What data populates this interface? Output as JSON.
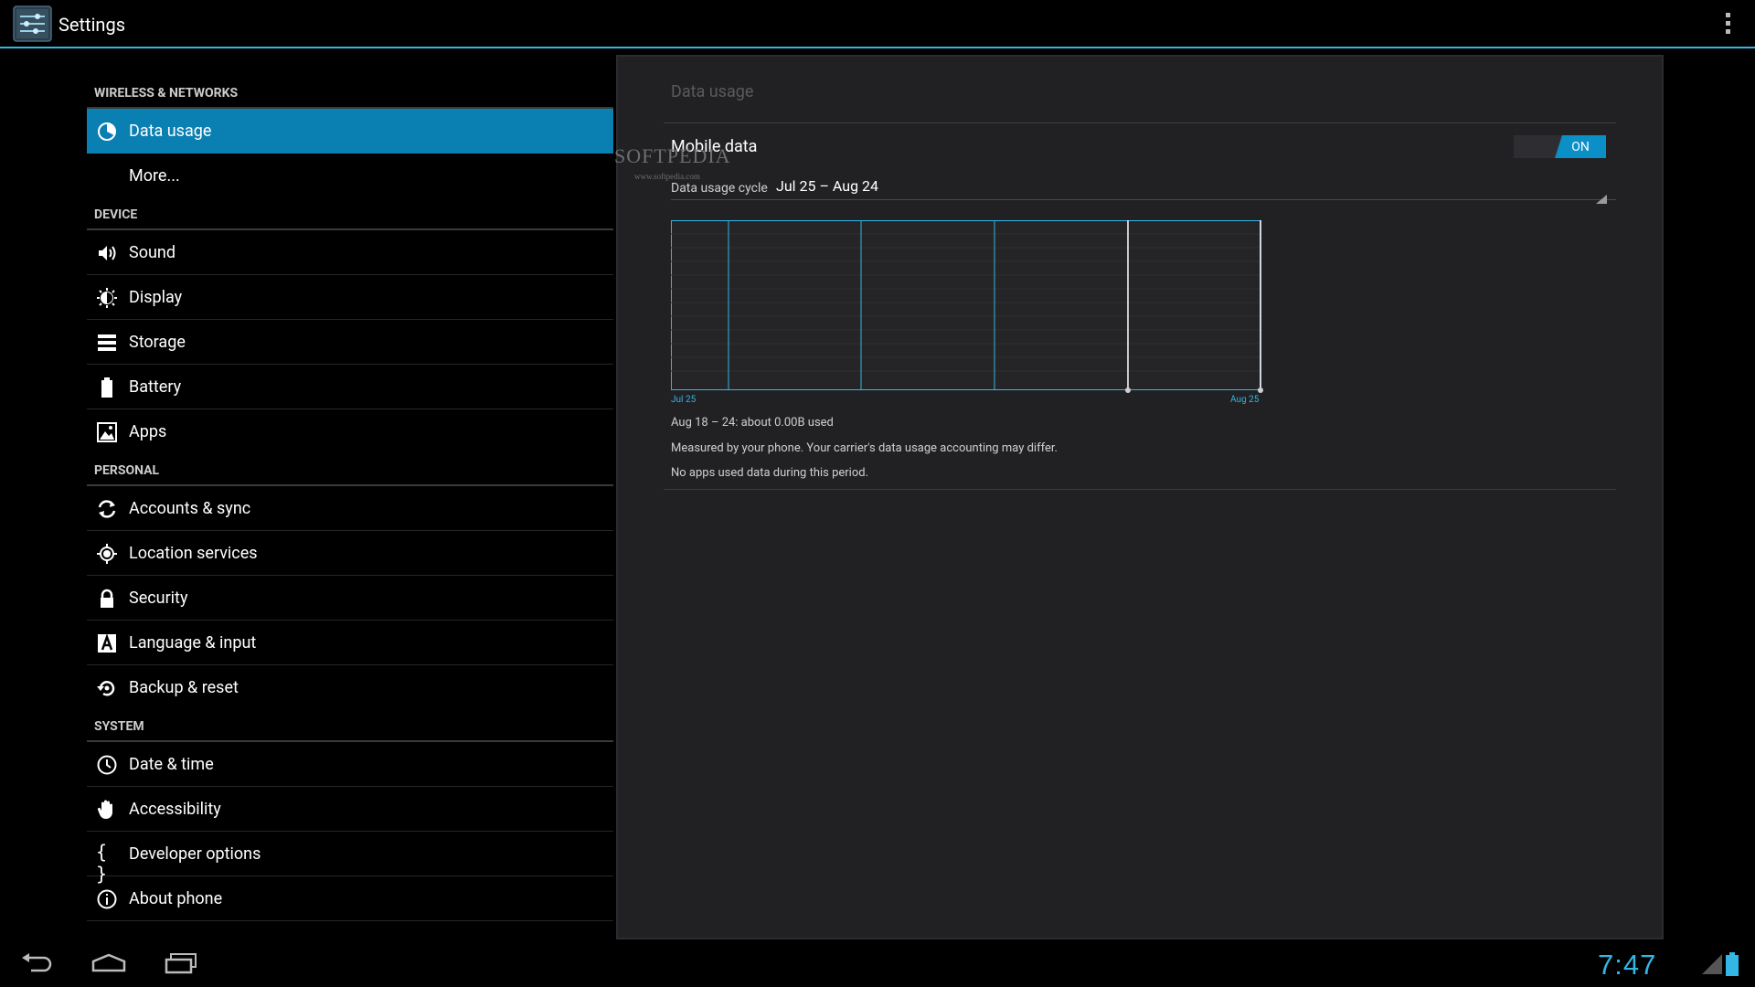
{
  "actionbar": {
    "title": "Settings",
    "icon": "settings-app-icon",
    "overflow_icon": "overflow-menu-icon"
  },
  "left": {
    "sections": [
      {
        "header": "WIRELESS & NETWORKS",
        "items": [
          {
            "label": "Data usage",
            "icon": "data-usage-icon",
            "selected": true
          },
          {
            "label": "More...",
            "icon": ""
          }
        ]
      },
      {
        "header": "DEVICE",
        "items": [
          {
            "label": "Sound",
            "icon": "sound-icon"
          },
          {
            "label": "Display",
            "icon": "display-icon"
          },
          {
            "label": "Storage",
            "icon": "storage-icon"
          },
          {
            "label": "Battery",
            "icon": "battery-icon"
          },
          {
            "label": "Apps",
            "icon": "apps-icon"
          }
        ]
      },
      {
        "header": "PERSONAL",
        "items": [
          {
            "label": "Accounts & sync",
            "icon": "sync-icon"
          },
          {
            "label": "Location services",
            "icon": "location-icon"
          },
          {
            "label": "Security",
            "icon": "lock-icon"
          },
          {
            "label": "Language & input",
            "icon": "language-icon"
          },
          {
            "label": "Backup & reset",
            "icon": "backup-icon"
          }
        ]
      },
      {
        "header": "SYSTEM",
        "items": [
          {
            "label": "Date & time",
            "icon": "clock-icon"
          },
          {
            "label": "Accessibility",
            "icon": "hand-icon"
          },
          {
            "label": "Developer options",
            "icon": "braces-icon",
            "glyph": "{ }"
          },
          {
            "label": "About phone",
            "icon": "info-icon"
          }
        ]
      }
    ]
  },
  "right": {
    "title": "Data usage",
    "mobile_data": {
      "label": "Mobile data",
      "toggle": "ON"
    },
    "cycle": {
      "label": "Data usage cycle",
      "value": "Jul 25 – Aug 24"
    },
    "chart": {
      "start_label": "Jul 25",
      "end_label": "Aug 25"
    },
    "summary": "Aug 18 – 24: about 0.00B used",
    "measured": "Measured by your phone. Your carrier's data usage accounting may differ.",
    "no_apps": "No apps used data during this period."
  },
  "watermark": {
    "brand": "SOFTPEDIA",
    "url": "www.softpedia.com"
  },
  "systembar": {
    "clock": "7:47",
    "back": "back-icon",
    "home": "home-icon",
    "recents": "recents-icon"
  },
  "colors": {
    "accent": "#33b5e5",
    "selected": "#0a7fb2",
    "toggle_on": "#0a8fc6",
    "panel_bg": "#212124"
  }
}
